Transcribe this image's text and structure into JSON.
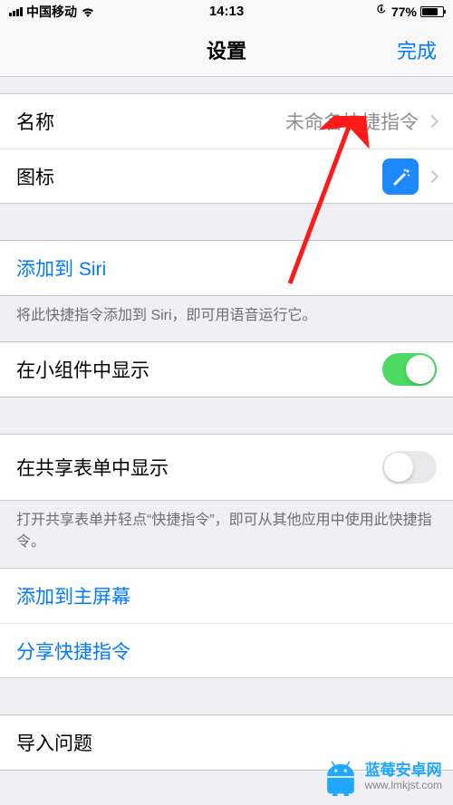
{
  "status": {
    "carrier": "中国移动",
    "time": "14:13",
    "battery_pct": "77%"
  },
  "nav": {
    "title": "设置",
    "done": "完成"
  },
  "section1": {
    "name_label": "名称",
    "name_value": "未命名快捷指令",
    "icon_label": "图标"
  },
  "siri": {
    "add_label": "添加到 Siri",
    "footer": "将此快捷指令添加到 Siri，即可用语音运行它。"
  },
  "widget": {
    "label": "在小组件中显示",
    "on": true
  },
  "share": {
    "label": "在共享表单中显示",
    "on": false,
    "footer": "打开共享表单并轻点“快捷指令”，即可从其他应用中使用此快捷指令。"
  },
  "actions": {
    "add_home": "添加到主屏幕",
    "share": "分享快捷指令"
  },
  "import": {
    "label": "导入问题"
  },
  "watermark": {
    "name": "蓝莓安卓网",
    "url": "www.lmkjst.com"
  }
}
